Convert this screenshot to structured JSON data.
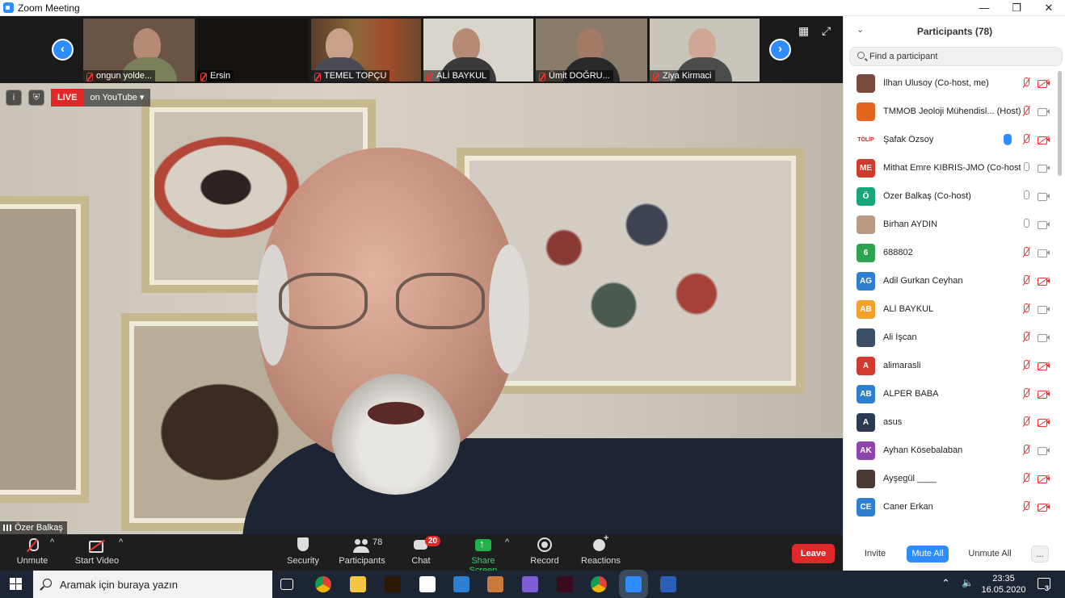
{
  "window": {
    "title": "Zoom Meeting",
    "controls": [
      "—",
      "❐",
      "✕"
    ]
  },
  "gallery": {
    "prev_arrow": "‹",
    "next_arrow": "›",
    "thumbnails": [
      {
        "name": "ongun yolde..."
      },
      {
        "name": "Ersin"
      },
      {
        "name": "TEMEL TOPÇU"
      },
      {
        "name": "ALİ BAYKUL"
      },
      {
        "name": "Ümit DOĞRU..."
      },
      {
        "name": "Ziya Kirmaci"
      }
    ],
    "gallery_view_icon": "▦",
    "fullscreen_icon": "⤢"
  },
  "stream": {
    "info_icon": "i",
    "security_icon": "⛨",
    "live_label": "LIVE",
    "destination_label": "on YouTube",
    "caret": "▾"
  },
  "active_speaker": {
    "name": "Özer Balkaş"
  },
  "toolbar": {
    "unmute_label": "Unmute",
    "start_video_label": "Start Video",
    "security_label": "Security",
    "participants_label": "Participants",
    "participants_count": "78",
    "chat_label": "Chat",
    "chat_badge": "20",
    "share_label": "Share Screen",
    "record_label": "Record",
    "reactions_label": "Reactions",
    "leave_label": "Leave",
    "caret": "^"
  },
  "panel": {
    "collapse_icon": "⌄",
    "title": "Participants (78)",
    "search_placeholder": "Find a participant",
    "participants": [
      {
        "initials": "",
        "name": "İlhan Ulusoy (Co-host, me)",
        "avatar_color": "#7a4a3a",
        "mic": "muted",
        "cam": "off"
      },
      {
        "initials": "",
        "name": "TMMOB Jeoloji Mühendisl... (Host)",
        "avatar_color": "#e2661f",
        "mic": "muted",
        "cam": "on"
      },
      {
        "initials": "TÖLİP",
        "name": "Şafak Özsoy",
        "avatar_color": "#ffffff",
        "mic": "muted",
        "cam": "off",
        "hand": true
      },
      {
        "initials": "ME",
        "name": "Mithat Emre KIBRIS-JMO (Co-host)",
        "avatar_color": "#d13b2e",
        "mic": "on",
        "cam": "on"
      },
      {
        "initials": "Ö",
        "name": "Özer Balkaş (Co-host)",
        "avatar_color": "#1aa67a",
        "mic": "on",
        "cam": "on"
      },
      {
        "initials": "",
        "name": "Birhan AYDIN",
        "avatar_color": "#b99a82",
        "mic": "on",
        "cam": "on"
      },
      {
        "initials": "6",
        "name": "688802",
        "avatar_color": "#2ea44f",
        "mic": "muted",
        "cam": "on"
      },
      {
        "initials": "AG",
        "name": "Adil Gurkan Ceyhan",
        "avatar_color": "#2d7fd1",
        "mic": "muted",
        "cam": "off"
      },
      {
        "initials": "AB",
        "name": "ALİ BAYKUL",
        "avatar_color": "#f2a22a",
        "mic": "muted",
        "cam": "on"
      },
      {
        "initials": "",
        "name": "Ali İşcan",
        "avatar_color": "#3b4e63",
        "mic": "muted",
        "cam": "on"
      },
      {
        "initials": "A",
        "name": "alimarasli",
        "avatar_color": "#d13b2e",
        "mic": "muted",
        "cam": "off"
      },
      {
        "initials": "AB",
        "name": "ALPER BABA",
        "avatar_color": "#2d7fd1",
        "mic": "muted",
        "cam": "off"
      },
      {
        "initials": "A",
        "name": "asus",
        "avatar_color": "#2b3a52",
        "mic": "muted",
        "cam": "off"
      },
      {
        "initials": "AK",
        "name": "Ayhan Kösebalaban",
        "avatar_color": "#8e44ad",
        "mic": "muted",
        "cam": "on"
      },
      {
        "initials": "",
        "name": "Ayşegül ____",
        "avatar_color": "#4a3a34",
        "mic": "muted",
        "cam": "off"
      },
      {
        "initials": "CE",
        "name": "Caner Erkan",
        "avatar_color": "#2d7fd1",
        "mic": "muted",
        "cam": "off"
      }
    ],
    "invite_label": "Invite",
    "mute_all_label": "Mute All",
    "unmute_all_label": "Unmute All",
    "more_label": "..."
  },
  "taskbar": {
    "search_placeholder": "Aramak için buraya yazın",
    "time": "23:35",
    "date": "16.05.2020",
    "tray_up": "⌃",
    "volume_icon": "🔈",
    "notification_count": "3",
    "apps": [
      {
        "name": "task-view",
        "color": "#1b2534"
      },
      {
        "name": "chrome",
        "color": "#e9b72c"
      },
      {
        "name": "file-explorer",
        "color": "#f4c542"
      },
      {
        "name": "illustrator",
        "color": "#2d1a06"
      },
      {
        "name": "store",
        "color": "#ffffff"
      },
      {
        "name": "mail",
        "color": "#2d7fd1"
      },
      {
        "name": "paint",
        "color": "#c97a3a"
      },
      {
        "name": "photos",
        "color": "#7d5ad6"
      },
      {
        "name": "indesign",
        "color": "#3a0a1e"
      },
      {
        "name": "chrome-2",
        "color": "#e9b72c"
      },
      {
        "name": "zoom",
        "color": "#2d8cff"
      },
      {
        "name": "word",
        "color": "#2b5eb7"
      }
    ]
  }
}
